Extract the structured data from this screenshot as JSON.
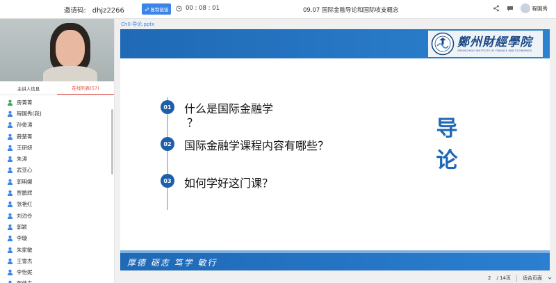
{
  "topbar": {
    "invite_label": "邀请码:",
    "invite_code": "dhjz2266",
    "copy_link_label": "复制链接",
    "timer": "00 : 08 : 01",
    "meeting_title": "09.07 国际金融导论和国际收支概念",
    "user_name": "程国秀"
  },
  "left_panel": {
    "tabs": [
      {
        "label": "主讲人信息"
      },
      {
        "label": "在线列表(57)"
      }
    ],
    "users": [
      {
        "name": "房菁菁"
      },
      {
        "name": "程国秀(我)"
      },
      {
        "name": "孙俊涛"
      },
      {
        "name": "薛楚菁"
      },
      {
        "name": "王研妍"
      },
      {
        "name": "朱涛"
      },
      {
        "name": "武亚心"
      },
      {
        "name": "郭明娜"
      },
      {
        "name": "贾鹏辉"
      },
      {
        "name": "张艳红"
      },
      {
        "name": "刘泊伶"
      },
      {
        "name": "郭颖"
      },
      {
        "name": "李璇"
      },
      {
        "name": "朱家敏"
      },
      {
        "name": "王雪杰"
      },
      {
        "name": "李怡妮"
      },
      {
        "name": "郭佳卉"
      }
    ]
  },
  "viewer": {
    "filename": "Ch0-导论.pptx",
    "slide": {
      "logo_cn": "鄭州財經學院",
      "logo_en": "ZHENGZHOU INSTITUTE OF FINANCE AND ECONOMICS",
      "items": [
        {
          "num": "01",
          "text_line1": "什么是国际金融学",
          "text_line2": "？"
        },
        {
          "num": "02",
          "text_line1": "国际金融学课程内容有哪些？",
          "text_line2": ""
        },
        {
          "num": "03",
          "text_line1": "如何学好这门课？",
          "text_line2": ""
        }
      ],
      "title_chars": [
        "导",
        "论"
      ],
      "motto": "厚德  砺志  笃学  敏行"
    },
    "pager": {
      "page": "2",
      "total": "/ 14页",
      "fit_label": "适合页面"
    }
  },
  "colors": {
    "accent_blue": "#1f69b6",
    "copy_button": "#3b84e8",
    "active_tab": "#e6483d",
    "host_icon": "#3aa757",
    "user_icon": "#3b84e8"
  }
}
